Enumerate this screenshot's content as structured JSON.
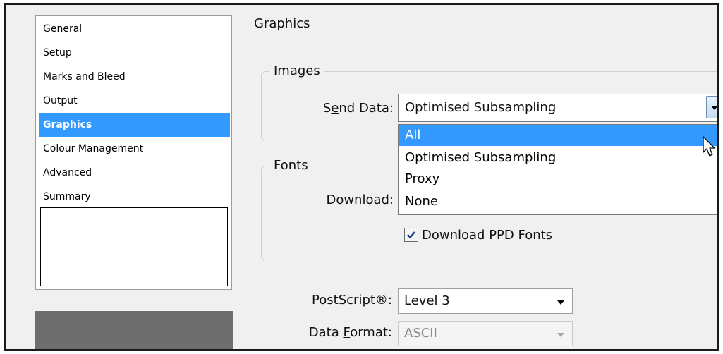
{
  "sidebar": {
    "items": [
      {
        "label": "General"
      },
      {
        "label": "Setup"
      },
      {
        "label": "Marks and Bleed"
      },
      {
        "label": "Output"
      },
      {
        "label": "Graphics",
        "selected": true
      },
      {
        "label": "Colour Management"
      },
      {
        "label": "Advanced"
      },
      {
        "label": "Summary"
      }
    ]
  },
  "main": {
    "section_title": "Graphics",
    "images": {
      "legend": "Images",
      "send_data_label_pre": "S",
      "send_data_label_mnemonic": "e",
      "send_data_label_post": "nd Data:",
      "send_data_value": "Optimised Subsampling",
      "dropdown_options": [
        "All",
        "Optimised Subsampling",
        "Proxy",
        "None"
      ],
      "highlighted_option": "All"
    },
    "fonts": {
      "legend": "Fonts",
      "download_label_pre": "D",
      "download_label_mnemonic": "o",
      "download_label_post": "wnload:",
      "download_ppd_label": "Download PPD Fonts",
      "download_ppd_checked": true
    },
    "postscript": {
      "label_pre": "PostS",
      "label_mnemonic": "c",
      "label_post": "ript®:",
      "value": "Level 3"
    },
    "data_format": {
      "label_pre": "Data ",
      "label_mnemonic": "F",
      "label_post": "ormat:",
      "value": "ASCII",
      "disabled": true
    }
  },
  "colors": {
    "selection": "#3399ff",
    "window_bg": "#f0f0f0"
  }
}
